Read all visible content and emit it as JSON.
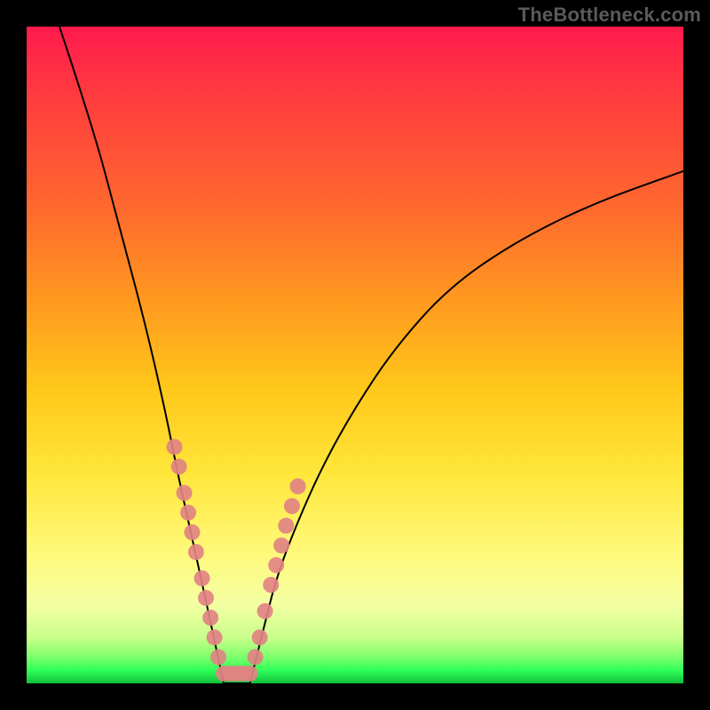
{
  "watermark": "TheBottleneck.com",
  "chart_data": {
    "type": "line",
    "title": "",
    "xlabel": "",
    "ylabel": "",
    "xlim": [
      0,
      100
    ],
    "ylim": [
      0,
      100
    ],
    "legend": false,
    "grid": false,
    "series": [
      {
        "name": "left-curve",
        "x": [
          5,
          10,
          14,
          18,
          21,
          23,
          25,
          27,
          28.5,
          30
        ],
        "y": [
          100,
          85,
          70,
          55,
          42,
          32,
          23,
          14,
          7,
          0
        ]
      },
      {
        "name": "right-curve",
        "x": [
          34,
          36,
          38,
          41,
          45,
          50,
          56,
          64,
          74,
          86,
          100
        ],
        "y": [
          0,
          8,
          16,
          24,
          33,
          42,
          51,
          60,
          67,
          73,
          78
        ]
      }
    ],
    "flat_bottom": {
      "x_start": 30,
      "x_end": 34,
      "y": 0
    },
    "scatter_points": {
      "name": "data-dots",
      "color": "#e18383",
      "points": [
        {
          "x": 22.5,
          "y": 36
        },
        {
          "x": 23.2,
          "y": 33
        },
        {
          "x": 24.0,
          "y": 29
        },
        {
          "x": 24.6,
          "y": 26
        },
        {
          "x": 25.2,
          "y": 23
        },
        {
          "x": 25.8,
          "y": 20
        },
        {
          "x": 26.7,
          "y": 16
        },
        {
          "x": 27.3,
          "y": 13
        },
        {
          "x": 28.0,
          "y": 10
        },
        {
          "x": 28.6,
          "y": 7
        },
        {
          "x": 29.2,
          "y": 4
        },
        {
          "x": 30.0,
          "y": 1.5
        },
        {
          "x": 31.0,
          "y": 1.5
        },
        {
          "x": 32.0,
          "y": 1.5
        },
        {
          "x": 33.0,
          "y": 1.5
        },
        {
          "x": 34.0,
          "y": 1.5
        },
        {
          "x": 34.8,
          "y": 4
        },
        {
          "x": 35.5,
          "y": 7
        },
        {
          "x": 36.3,
          "y": 11
        },
        {
          "x": 37.2,
          "y": 15
        },
        {
          "x": 38.0,
          "y": 18
        },
        {
          "x": 38.8,
          "y": 21
        },
        {
          "x": 39.5,
          "y": 24
        },
        {
          "x": 40.4,
          "y": 27
        },
        {
          "x": 41.3,
          "y": 30
        }
      ]
    }
  }
}
